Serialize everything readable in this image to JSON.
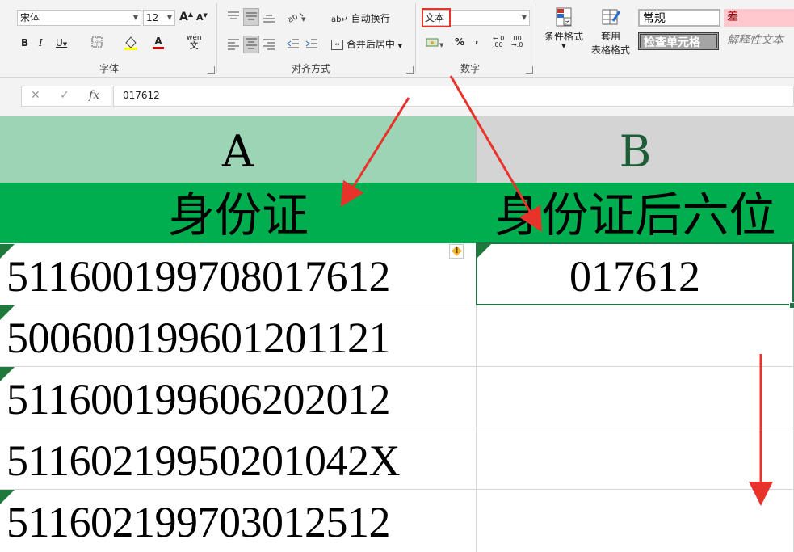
{
  "ribbon": {
    "font": {
      "group_label": "字体",
      "font_name": "宋体",
      "font_size": "12",
      "grow_label": "A",
      "shrink_label": "A",
      "bold": "B",
      "italic": "I",
      "underline": "U",
      "font_color_label": "A",
      "phonetic_top": "wén",
      "phonetic_bottom": "文"
    },
    "alignment": {
      "group_label": "对齐方式",
      "wrap_text": "自动换行",
      "merge_center": "合并后居中"
    },
    "number": {
      "group_label": "数字",
      "format_value": "文本",
      "percent": "%",
      "comma": ",",
      "inc_decimal": "←.0\n.00",
      "dec_decimal": ".00\n→.0"
    },
    "styles": {
      "conditional_format": "条件格式",
      "format_as_table_top": "套用",
      "format_as_table_bottom": "表格格式",
      "normal": "常规",
      "bad": "差",
      "check_cell": "检查单元格",
      "explanatory": "解释性文本"
    }
  },
  "formula_bar": {
    "cancel": "✕",
    "enter": "✓",
    "fx": "fx",
    "content": "017612"
  },
  "sheet": {
    "col_a": "A",
    "col_b": "B",
    "header_a": "身份证",
    "header_b": "身份证后六位",
    "rows": [
      {
        "a": "511600199708017612",
        "b": "017612",
        "flag": true
      },
      {
        "a": "500600199601201121",
        "b": "",
        "flag": true
      },
      {
        "a": "511600199606202012",
        "b": "",
        "flag": true
      },
      {
        "a": "51160219950201042X",
        "b": "",
        "flag": false
      },
      {
        "a": "511602199703012512",
        "b": "",
        "flag": true
      }
    ]
  },
  "colors": {
    "header_green": "#00ad4f",
    "col_a_bg": "#9dd4b5",
    "col_b_bg": "#d4d4d4",
    "selection": "#217346",
    "annotation": "#e8332a"
  }
}
